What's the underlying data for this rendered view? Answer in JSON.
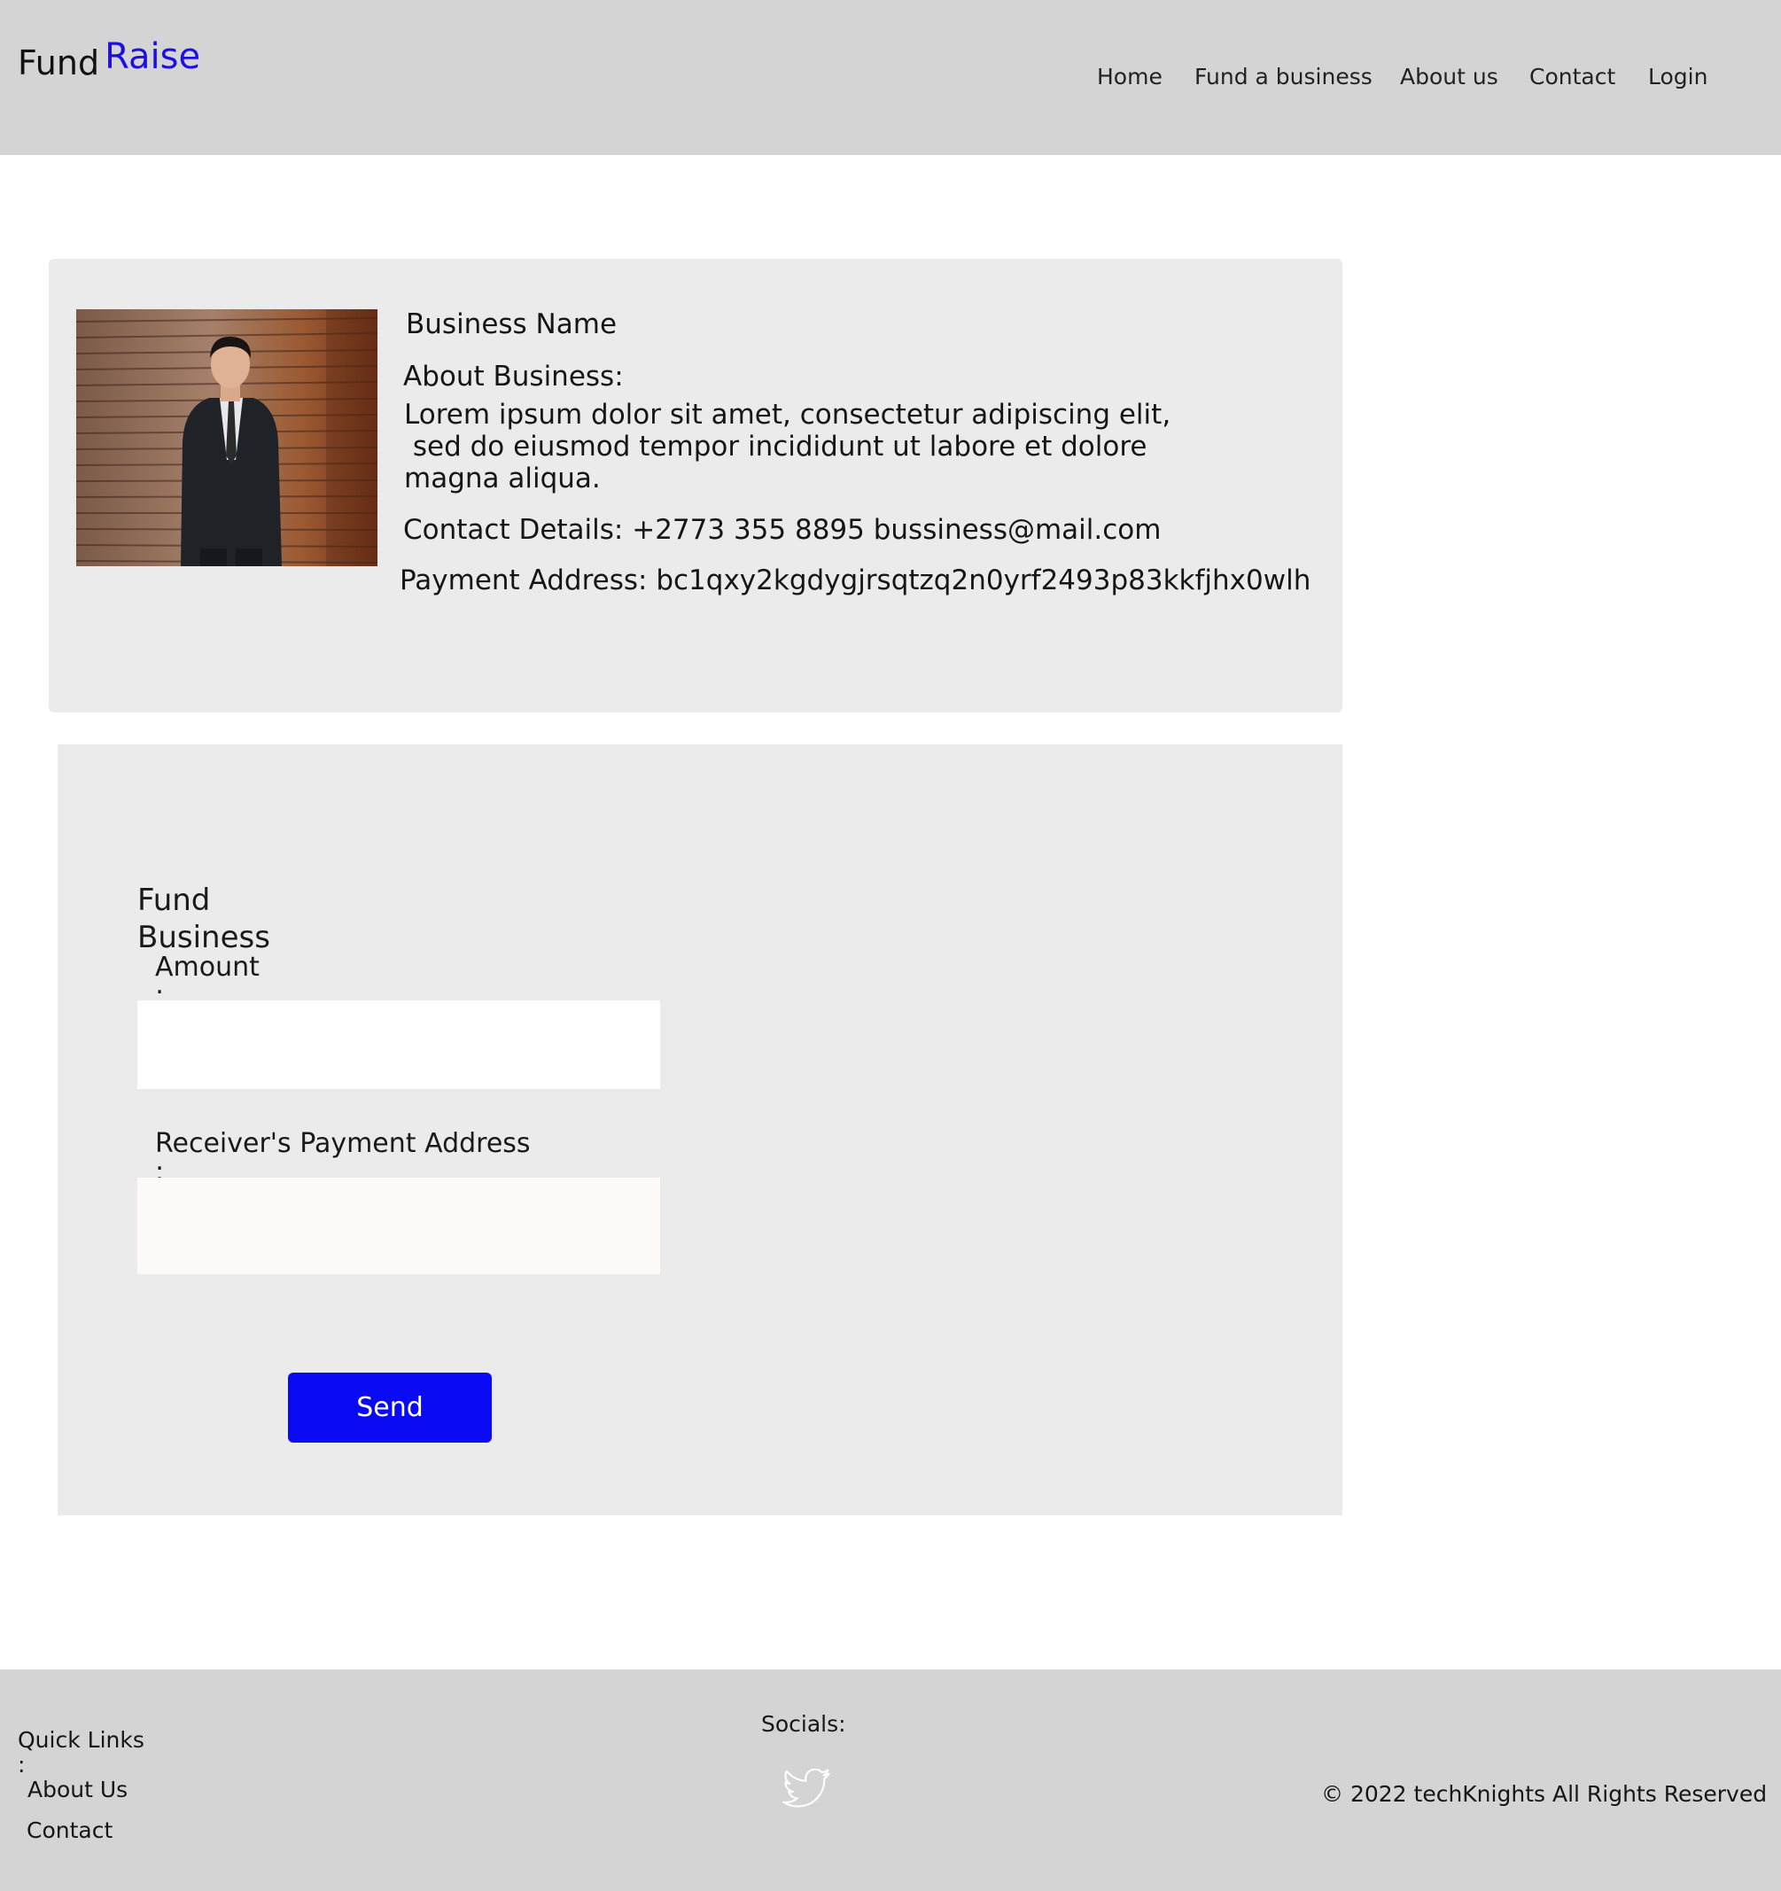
{
  "brand": {
    "fund": "Fund",
    "raise": "Raise",
    "raise_color": "#1d0fe0"
  },
  "nav": {
    "home": "Home",
    "fund_a_business": "Fund a business",
    "about_us": "About us",
    "contact": "Contact",
    "login": "Login"
  },
  "business": {
    "name": "Business Name",
    "about_label": "About Business:",
    "about_line1": "Lorem ipsum dolor sit amet, consectetur adipiscing elit,",
    "about_line2": " sed do eiusmod tempor incididunt ut labore et dolore",
    "about_line3": "magna aliqua.",
    "contact": "Contact Details: +2773 355 8895 bussiness@mail.com",
    "payment_address": "Payment Address: bc1qxy2kgdygjrsqtzq2n0yrf2493p83kkfjhx0wlh",
    "photo_icon": "businessman-photo"
  },
  "form": {
    "title": "Fund Business",
    "amount_label": "Amount\n:",
    "amount_value": "",
    "receiver_label": "Receiver's Payment Address\n:",
    "receiver_value": "",
    "send_label": "Send",
    "send_color": "#0a0af5"
  },
  "footer": {
    "quick_links_label": "Quick Links\n:",
    "about_us": "About Us",
    "contact": "Contact",
    "socials_label": "Socials:",
    "social_icon": "twitter-icon",
    "copyright": "© 2022 techKnights All Rights Reserved"
  }
}
